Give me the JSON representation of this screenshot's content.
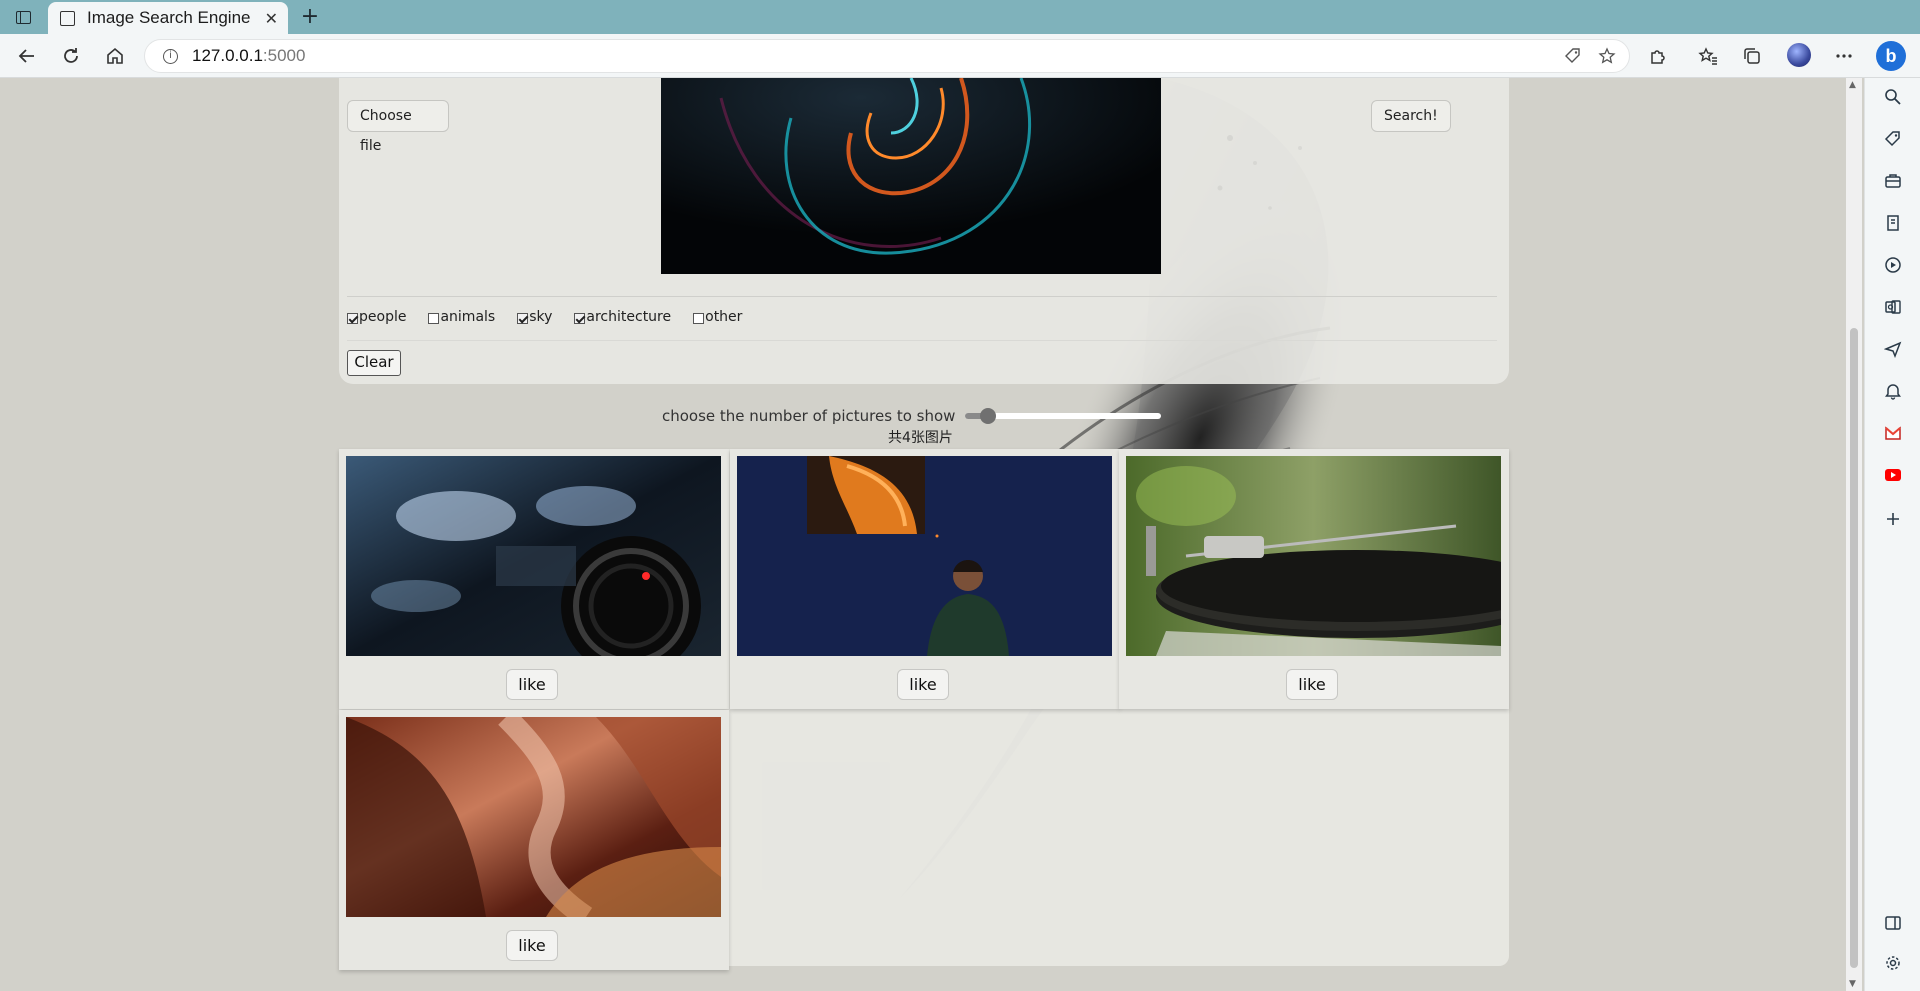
{
  "browser": {
    "tab_title": "Image Search Engine",
    "tab_close_glyph": "✕",
    "new_tab_glyph": "+",
    "url_host": "127.0.0.1",
    "url_port": ":5000",
    "profile_letter": "b"
  },
  "uploader": {
    "choose_file_label": "Choose file",
    "search_label": "Search!"
  },
  "categories": [
    {
      "label": "people",
      "checked": true
    },
    {
      "label": "animals",
      "checked": false
    },
    {
      "label": "sky",
      "checked": true
    },
    {
      "label": "architecture",
      "checked": true
    },
    {
      "label": "other",
      "checked": false
    }
  ],
  "clear_label": "Clear",
  "slider": {
    "label": "choose the number of pictures to show",
    "level": 0.08
  },
  "result_count_text": "共4张图片",
  "results": [
    {
      "subject": "camera close-up",
      "like_label": "like"
    },
    {
      "subject": "man against blue wall",
      "like_label": "like"
    },
    {
      "subject": "turntable record player",
      "like_label": "like"
    },
    {
      "subject": "red sandstone canyon",
      "like_label": "like"
    }
  ],
  "colors": {
    "tab_strip": "#7fb2bb",
    "page_bg": "#d2d1ca",
    "panel_bg": "#e8e8e3"
  }
}
